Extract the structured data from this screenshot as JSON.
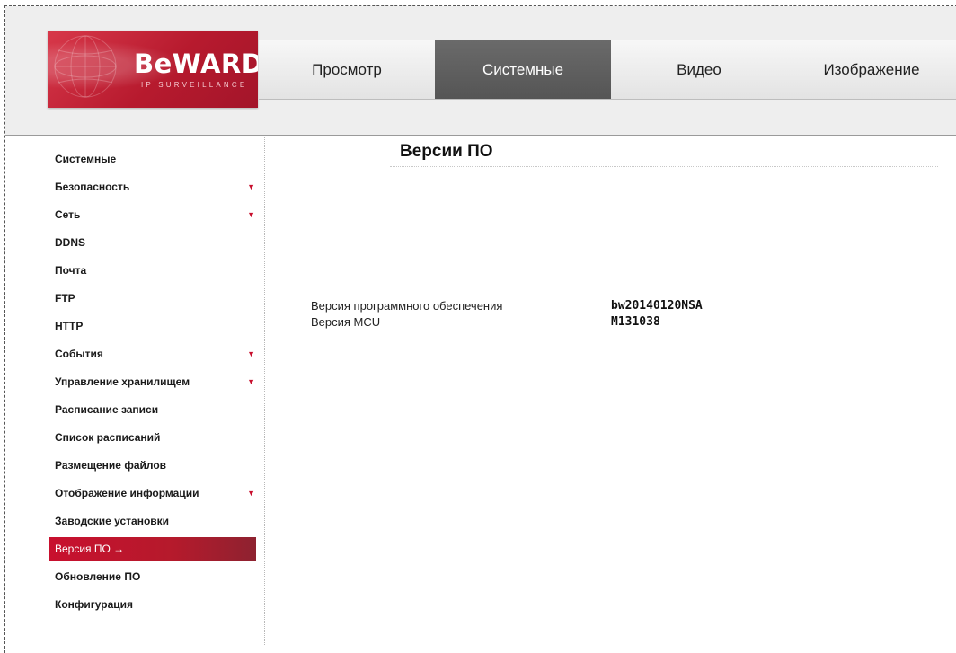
{
  "brand": {
    "name": "BeWARD",
    "tagline": "IP SURVEILLANCE"
  },
  "nav": {
    "tabs": [
      {
        "label": "Просмотр",
        "active": false
      },
      {
        "label": "Системные",
        "active": true
      },
      {
        "label": "Видео",
        "active": false
      },
      {
        "label": "Изображение",
        "active": false
      }
    ]
  },
  "sidebar": {
    "items": [
      {
        "label": "Системные",
        "has_submenu": false,
        "active": false
      },
      {
        "label": "Безопасность",
        "has_submenu": true,
        "active": false
      },
      {
        "label": "Сеть",
        "has_submenu": true,
        "active": false
      },
      {
        "label": "DDNS",
        "has_submenu": false,
        "active": false
      },
      {
        "label": "Почта",
        "has_submenu": false,
        "active": false
      },
      {
        "label": "FTP",
        "has_submenu": false,
        "active": false
      },
      {
        "label": "HTTP",
        "has_submenu": false,
        "active": false
      },
      {
        "label": "События",
        "has_submenu": true,
        "active": false
      },
      {
        "label": "Управление хранилищем",
        "has_submenu": true,
        "active": false
      },
      {
        "label": "Расписание записи",
        "has_submenu": false,
        "active": false
      },
      {
        "label": "Список расписаний",
        "has_submenu": false,
        "active": false
      },
      {
        "label": "Размещение файлов",
        "has_submenu": false,
        "active": false
      },
      {
        "label": "Отображение информации",
        "has_submenu": true,
        "active": false
      },
      {
        "label": "Заводские установки",
        "has_submenu": false,
        "active": false
      },
      {
        "label": "Версия ПО →",
        "has_submenu": false,
        "active": true
      },
      {
        "label": "Обновление ПО",
        "has_submenu": false,
        "active": false
      },
      {
        "label": "Конфигурация",
        "has_submenu": false,
        "active": false
      }
    ],
    "submenu_marker": "▼"
  },
  "main": {
    "title": "Версии ПО",
    "rows": [
      {
        "label": "Версия программного обеспечения",
        "value": "bw20140120NSA"
      },
      {
        "label": "Версия MCU",
        "value": "M131038"
      }
    ]
  },
  "colors": {
    "accent": "#c8102e",
    "active_tab": "#5e5e5e",
    "header_bg": "#eeeeee"
  }
}
